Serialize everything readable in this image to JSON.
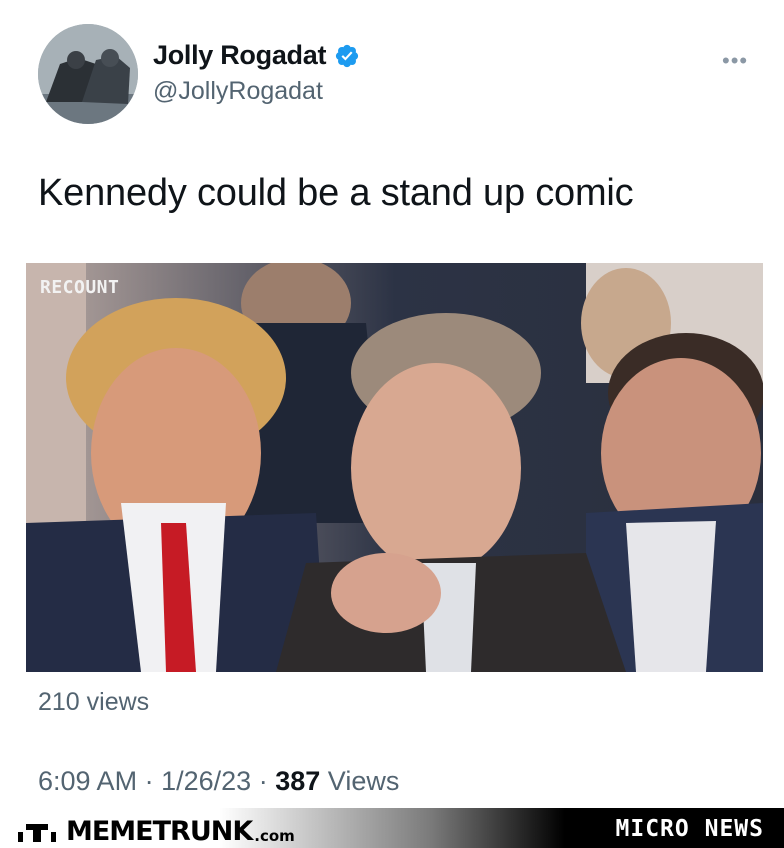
{
  "tweet": {
    "display_name": "Jolly Rogadat",
    "handle": "@JollyRogadat",
    "verified": true,
    "more_icon": "more-icon",
    "text": "Kennedy could be a stand up comic",
    "media": {
      "overlay_label": "RECOUNT"
    },
    "view_count_label": "210 views",
    "time": "6:09 AM",
    "separator": "·",
    "date": "1/26/23",
    "views_number": "387",
    "views_word": "Views"
  },
  "footer": {
    "brand": "MEMETRUNK",
    "brand_suffix": ".com",
    "tag": "MICRO NEWS"
  },
  "colors": {
    "verified": "#1d9bf0",
    "secondary_text": "#536471",
    "primary_text": "#0f1419"
  }
}
